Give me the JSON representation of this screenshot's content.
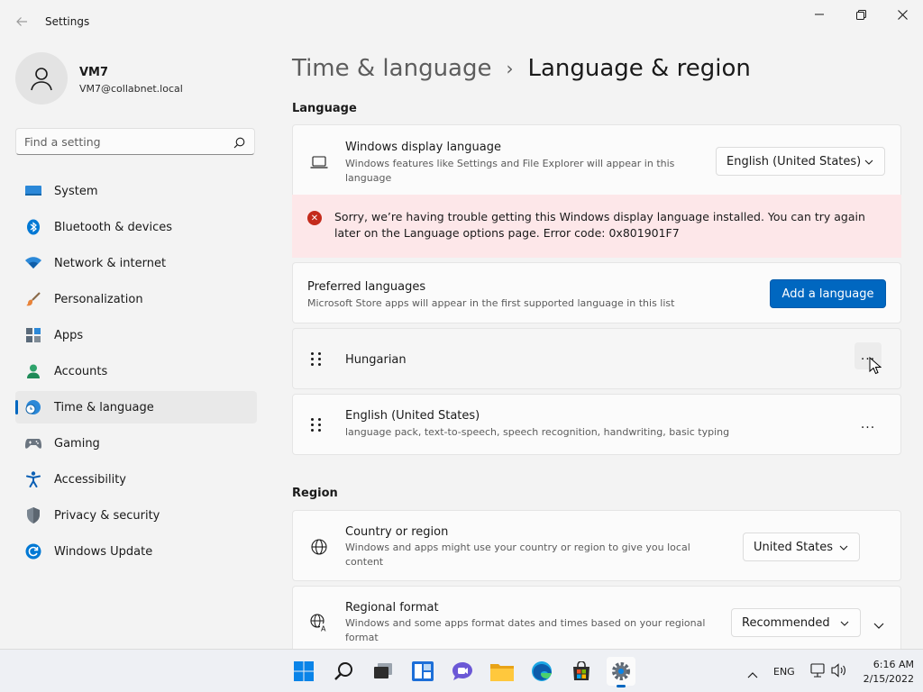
{
  "window": {
    "title": "Settings"
  },
  "user": {
    "name": "VM7",
    "email": "VM7@collabnet.local"
  },
  "search": {
    "placeholder": "Find a setting"
  },
  "nav": [
    {
      "label": "System",
      "icon": "monitor-icon"
    },
    {
      "label": "Bluetooth & devices",
      "icon": "bluetooth-icon"
    },
    {
      "label": "Network & internet",
      "icon": "wifi-icon"
    },
    {
      "label": "Personalization",
      "icon": "paintbrush-icon"
    },
    {
      "label": "Apps",
      "icon": "apps-icon"
    },
    {
      "label": "Accounts",
      "icon": "person-icon"
    },
    {
      "label": "Time & language",
      "icon": "globe-clock-icon",
      "active": true
    },
    {
      "label": "Gaming",
      "icon": "gamepad-icon"
    },
    {
      "label": "Accessibility",
      "icon": "accessibility-icon"
    },
    {
      "label": "Privacy & security",
      "icon": "shield-icon"
    },
    {
      "label": "Windows Update",
      "icon": "update-icon"
    }
  ],
  "breadcrumb": {
    "parent": "Time & language",
    "separator": "›",
    "current": "Language & region"
  },
  "language_section": {
    "title": "Language",
    "display_language": {
      "title": "Windows display language",
      "subtitle": "Windows features like Settings and File Explorer will appear in this language",
      "value": "English (United States)"
    },
    "error": {
      "message": "Sorry, we’re having trouble getting this Windows display language installed. You can try again later on the Language options page. Error code: 0x801901F7"
    },
    "preferred": {
      "title": "Preferred languages",
      "subtitle": "Microsoft Store apps will appear in the first supported language in this list",
      "add_button": "Add a language"
    },
    "languages": [
      {
        "name": "Hungarian",
        "details": ""
      },
      {
        "name": "English (United States)",
        "details": "language pack, text-to-speech, speech recognition, handwriting, basic typing"
      }
    ],
    "more_label": "..."
  },
  "region_section": {
    "title": "Region",
    "country": {
      "title": "Country or region",
      "subtitle": "Windows and apps might use your country or region to give you local content",
      "value": "United States"
    },
    "format": {
      "title": "Regional format",
      "subtitle": "Windows and some apps format dates and times based on your regional format",
      "value": "Recommended"
    }
  },
  "taskbar": {
    "input_language": "ENG",
    "time": "6:16 AM",
    "date": "2/15/2022"
  },
  "colors": {
    "accent": "#0067c0",
    "error_bg": "#fde7e9",
    "error_icon": "#c42b1c"
  }
}
